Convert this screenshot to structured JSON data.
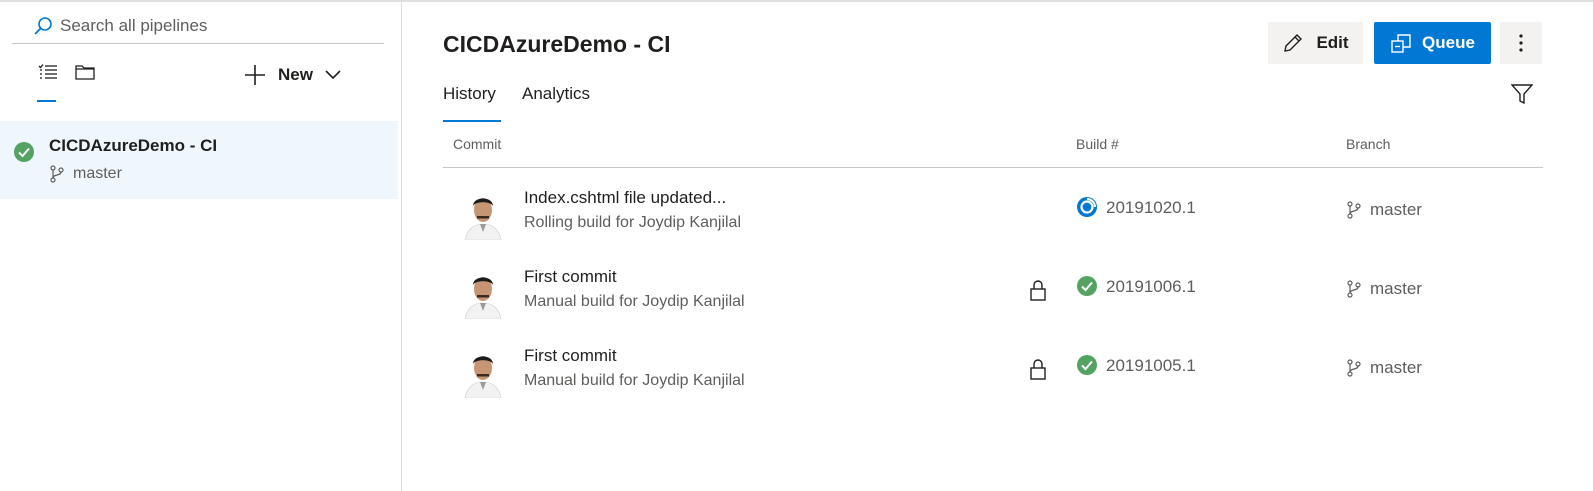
{
  "sidebar": {
    "search_placeholder": "Search all pipelines",
    "new_label": "New",
    "pipeline": {
      "name": "CICDAzureDemo - CI",
      "branch": "master",
      "status": "succeeded"
    }
  },
  "main": {
    "title": "CICDAzureDemo - CI",
    "edit_label": "Edit",
    "queue_label": "Queue",
    "tabs": [
      {
        "label": "History",
        "selected": true
      },
      {
        "label": "Analytics",
        "selected": false
      }
    ],
    "columns": {
      "commit": "Commit",
      "build": "Build #",
      "branch": "Branch"
    },
    "rows": [
      {
        "title": "Index.cshtml file updated...",
        "subtitle": "Rolling build for Joydip Kanjilal",
        "build": "20191020.1",
        "branch": "master",
        "status": "in-progress",
        "retained": false
      },
      {
        "title": "First commit",
        "subtitle": "Manual build for Joydip Kanjilal",
        "build": "20191006.1",
        "branch": "master",
        "status": "succeeded",
        "retained": true
      },
      {
        "title": "First commit",
        "subtitle": "Manual build for Joydip Kanjilal",
        "build": "20191005.1",
        "branch": "master",
        "status": "succeeded",
        "retained": true
      }
    ]
  },
  "colors": {
    "accent": "#0078d4",
    "success": "#55a362",
    "selected_bg": "#eff6fc"
  }
}
